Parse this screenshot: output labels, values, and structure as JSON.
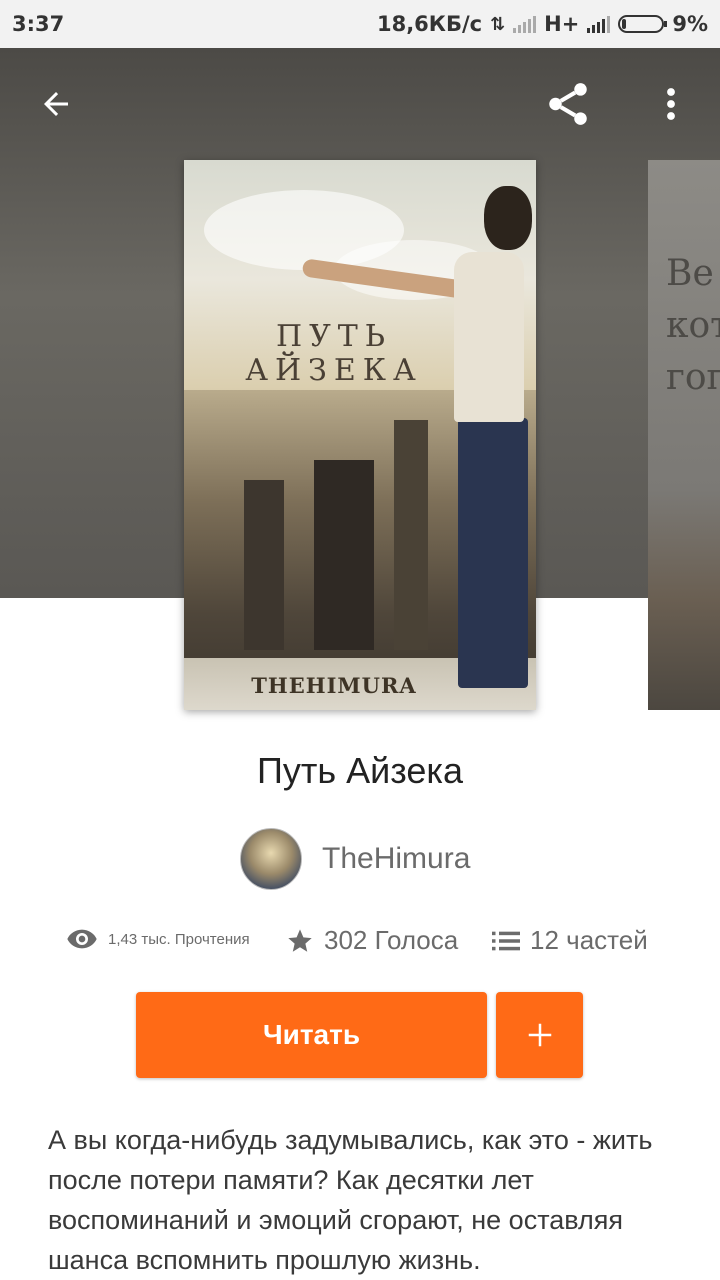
{
  "status_bar": {
    "time": "3:37",
    "network_speed": "18,6КБ/с",
    "network_type": "H+",
    "battery": "9%"
  },
  "toolbar": {
    "back_icon": "arrow-left-icon",
    "share_icon": "share-icon",
    "more_icon": "more-vertical-icon"
  },
  "cover": {
    "title_line1": "ПУТЬ",
    "title_line2": "АЙЗЕКА",
    "author": "THEHIMURA"
  },
  "next_cover": {
    "text_line1": "Ве",
    "text_line2": "кот",
    "text_line3": "гог"
  },
  "book": {
    "title": "Путь Айзека",
    "author": "TheHimura"
  },
  "stats": {
    "reads": "1,43 тыс. Прочтения",
    "votes": "302 Голоса",
    "parts": "12 частей"
  },
  "actions": {
    "read_label": "Читать",
    "add_label": "+"
  },
  "description": "А вы когда-нибудь задумывались, как это - жить после потери памяти? Как десятки лет воспоминаний и эмоций сгорают, не оставляя шанса вспомнить прошлую жизнь.",
  "colors": {
    "accent": "#ff6a16",
    "status_bar_bg": "#f2f2f2",
    "hero_bg": "#5c5a56"
  }
}
